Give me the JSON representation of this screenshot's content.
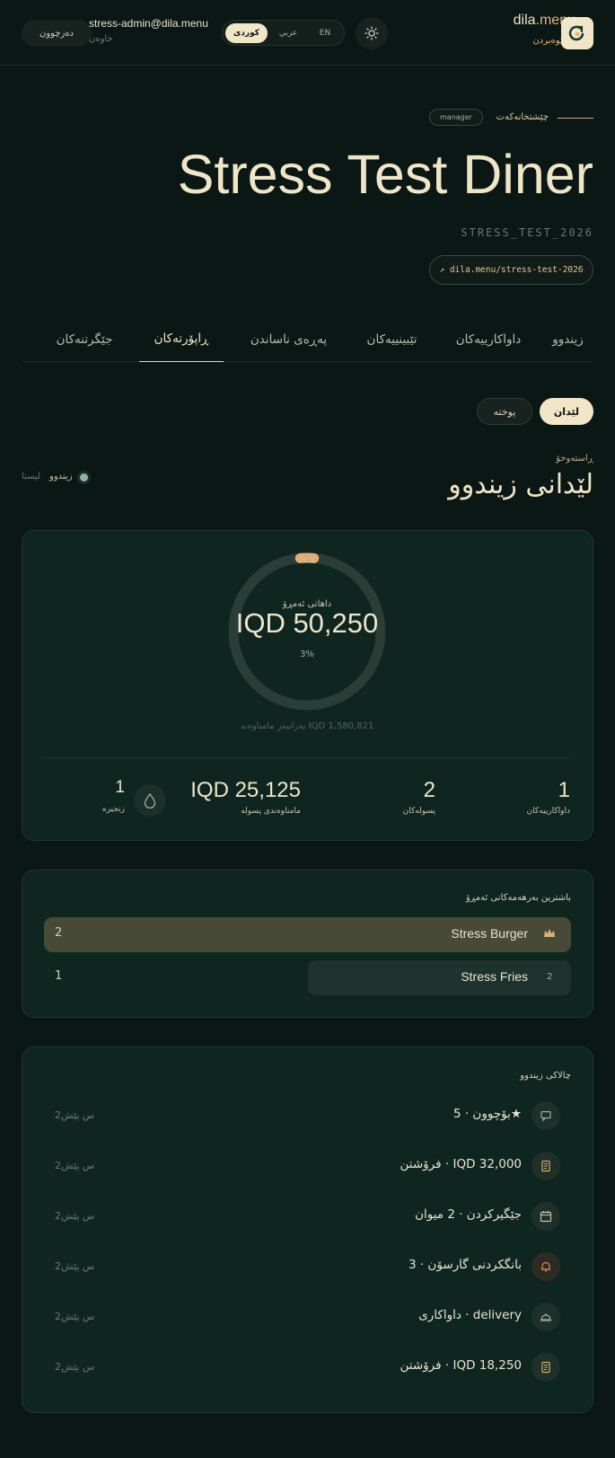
{
  "header": {
    "logout_label": "دەرچوون",
    "user_email": "stress-admin@dila.menu",
    "user_role": "خاوەن",
    "languages": [
      "کوردی",
      "عربي",
      "EN"
    ],
    "active_language": "کوردی",
    "brand_name": "dila",
    "brand_suffix": ".menu",
    "brand_subtitle": "بەڕێوەبردن"
  },
  "hero": {
    "eyebrow": "چێشتخانەکەت",
    "role_chip": "manager",
    "restaurant_name": "Stress Test Diner",
    "slug": "STRESS_TEST_2026",
    "url_label": "↗ dila.menu/stress-test-2026"
  },
  "tabs": [
    "زیندوو",
    "داواکارییەکان",
    "تێبینییەکان",
    "پەڕەی ناساندن",
    "ڕاپۆرتەکان",
    "جێگرتنەکان"
  ],
  "active_tab": "ڕاپۆرتەکان",
  "view_toggle": {
    "active": "لێدان",
    "inactive": "پوختە"
  },
  "section": {
    "eyebrow": "ڕاستەوخۆ",
    "title": "لێدانی زیندوو",
    "live_label": "زیندوو",
    "list_label": "لیستا"
  },
  "revenue": {
    "label": "داهاتی ئەمڕۆ",
    "value": "IQD 50,250",
    "percent_label": "3%",
    "progress": 0.03,
    "target_line": "بەرانبەر مامناوەند IQD 1,580,821"
  },
  "stats": [
    {
      "value": "1",
      "label": "داواکارییەکان"
    },
    {
      "value": "2",
      "label": "پسولەکان"
    },
    {
      "value": "IQD 25,125",
      "label": "مامناوەندی پسولە"
    },
    {
      "value": "1",
      "label": "زنجیرە"
    }
  ],
  "top_items": {
    "title": "باشترین بەرهەمەکانی ئەمڕۆ",
    "items": [
      {
        "name": "Stress Burger",
        "count": "2",
        "rank": "",
        "icon": "crown-icon"
      },
      {
        "name": "Stress Fries",
        "count": "1",
        "rank": "2",
        "icon": ""
      }
    ]
  },
  "activity": {
    "title": "چالاکی زیندوو",
    "items": [
      {
        "text": "بۆچوون · 5★",
        "time": "2س پێش",
        "icon": "chat-icon",
        "color": "#8fb39a"
      },
      {
        "text": "فرۆشتن · IQD 32,000",
        "time": "2س پێش",
        "icon": "receipt-icon",
        "color": "#d9b06a"
      },
      {
        "text": "جێگیرکردن · 2 میوان",
        "time": "2س پێش",
        "icon": "calendar-icon",
        "color": "#c9c2ad"
      },
      {
        "text": "بانگکردنی گارسۆن · 3",
        "time": "2س پێش",
        "icon": "bell-icon",
        "color": "#e58a55"
      },
      {
        "text": "داواکاری · delivery",
        "time": "2س پێش",
        "icon": "cloche-icon",
        "color": "#8fb39a"
      },
      {
        "text": "فرۆشتن · IQD 18,250",
        "time": "2س پێش",
        "icon": "receipt-icon",
        "color": "#d9b06a"
      }
    ]
  },
  "colors": {
    "accent": "#e8b47a",
    "cream": "#f2e6c8",
    "background": "#0b1714",
    "card": "#0f2520"
  }
}
